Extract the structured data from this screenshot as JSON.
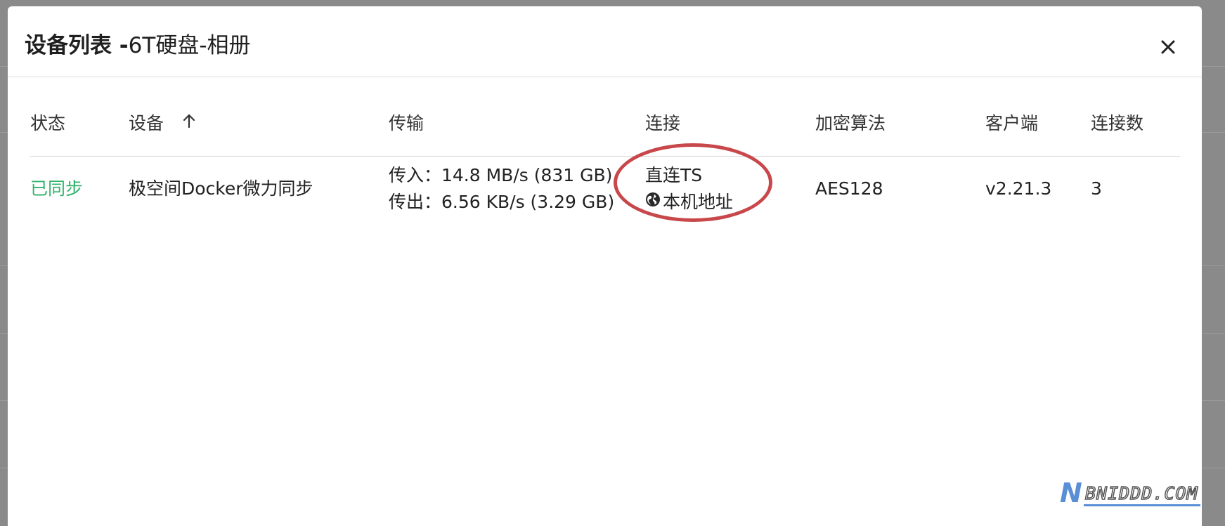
{
  "modal": {
    "title_strong": "设备列表 -",
    "title_sub": "6T硬盘-相册",
    "close_icon": "close-icon"
  },
  "table": {
    "headers": {
      "status": "状态",
      "device": "设备",
      "transfer": "传输",
      "connection": "连接",
      "encryption": "加密算法",
      "client": "客户端",
      "connections": "连接数"
    },
    "sort": {
      "column": "device",
      "direction": "ascending",
      "icon": "arrow-up-icon"
    },
    "rows": [
      {
        "status": "已同步",
        "status_color": "#2fb36b",
        "device": "极空间Docker微力同步",
        "transfer_in": "传入：14.8 MB/s (831 GB)",
        "transfer_out": "传出：6.56 KB/s (3.29 GB)",
        "connection_type": "直连TS",
        "connection_address": "本机地址",
        "connection_icon": "globe-icon",
        "encryption": "AES128",
        "client": "v2.21.3",
        "connections": "3"
      }
    ]
  },
  "annotation": {
    "color": "#c8474a",
    "shape": "ellipse"
  },
  "watermark": {
    "logo_letter": "N",
    "text": "BNIDDD.COM"
  }
}
